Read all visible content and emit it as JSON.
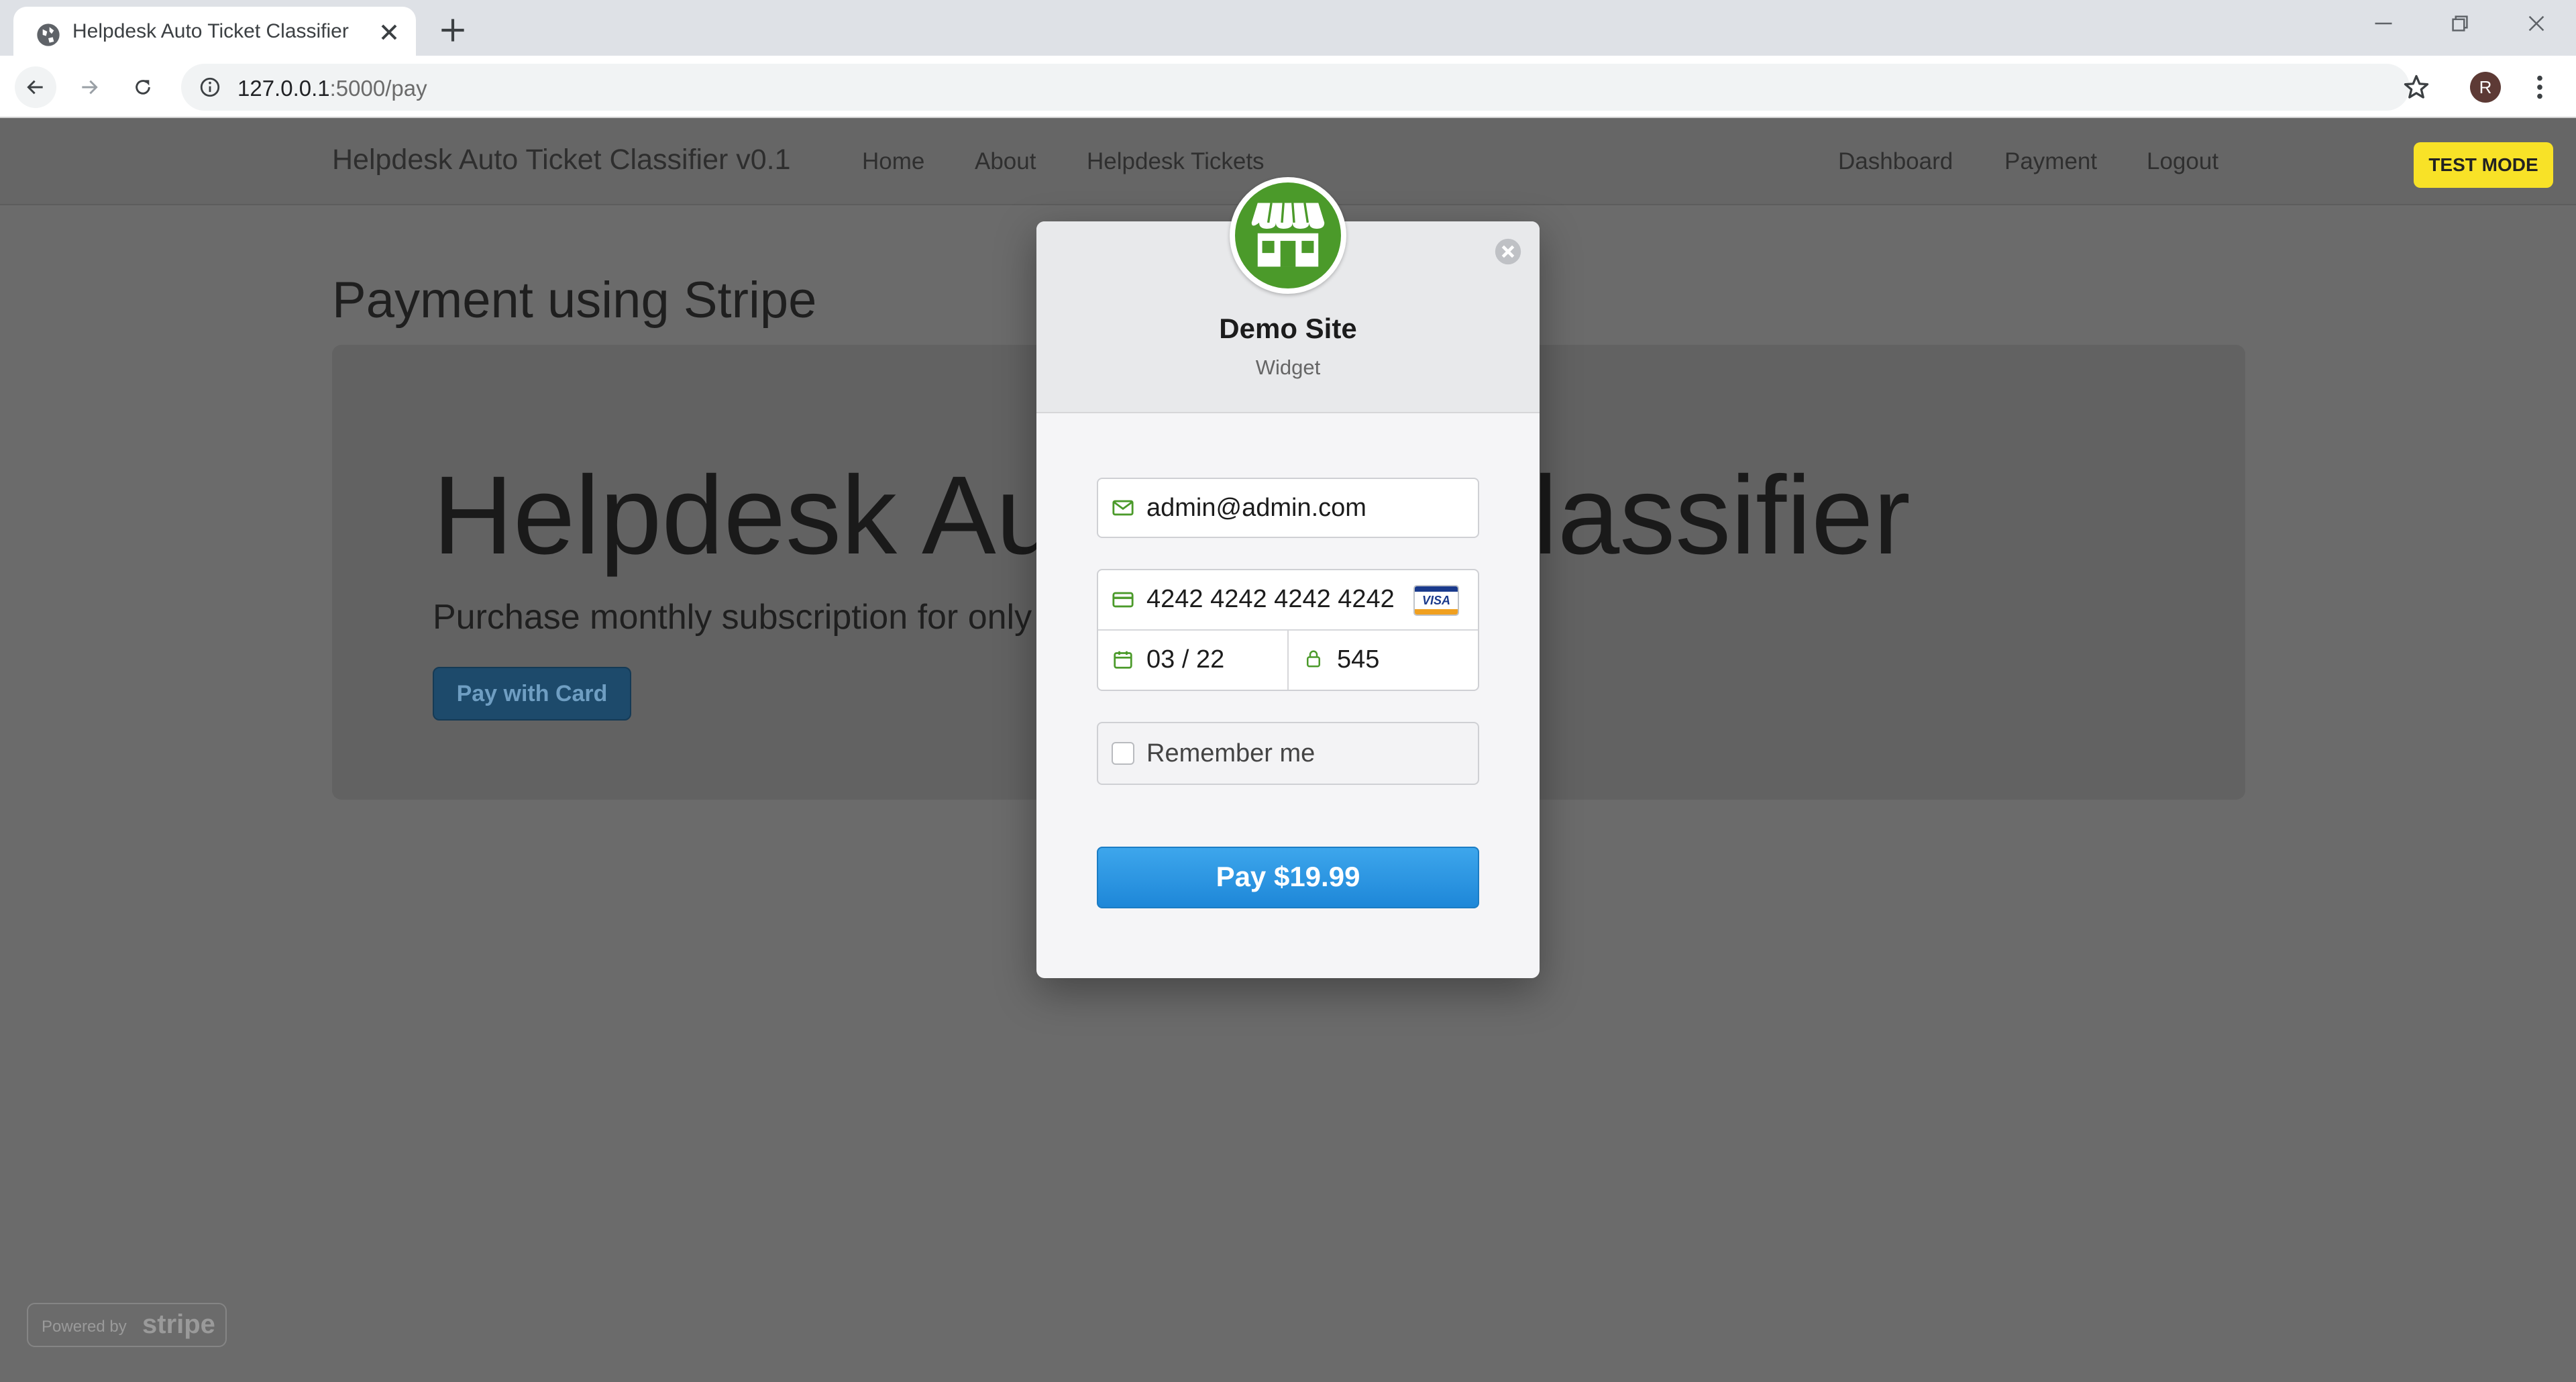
{
  "browser": {
    "tab_title": "Helpdesk Auto Ticket Classifier",
    "url_host": "127.0.0.1",
    "url_path": ":5000/pay",
    "profile_initial": "R"
  },
  "navbar": {
    "brand": "Helpdesk Auto Ticket Classifier v0.1",
    "links_left": [
      "Home",
      "About",
      "Helpdesk Tickets"
    ],
    "links_right": [
      "Dashboard",
      "Payment",
      "Logout"
    ]
  },
  "page": {
    "heading": "Payment using Stripe",
    "jumbo_title_left": "Helpdesk Au",
    "jumbo_title_right": "lassifier",
    "jumbo_lead": "Purchase monthly subscription for only",
    "pay_with_card": "Pay with Card"
  },
  "stripe": {
    "test_mode": "TEST MODE",
    "site_name": "Demo Site",
    "site_sub": "Widget",
    "email": "admin@admin.com",
    "card_number": "4242 4242 4242 4242",
    "card_brand": "VISA",
    "expiry": "03 / 22",
    "cvc": "545",
    "remember_label": "Remember me",
    "pay_button": "Pay $19.99",
    "powered_by": "Powered by",
    "powered_brand": "stripe"
  },
  "colors": {
    "accent_blue": "#2b95e1",
    "logo_green": "#4b9a2a",
    "test_mode_yellow": "#f8e227"
  }
}
